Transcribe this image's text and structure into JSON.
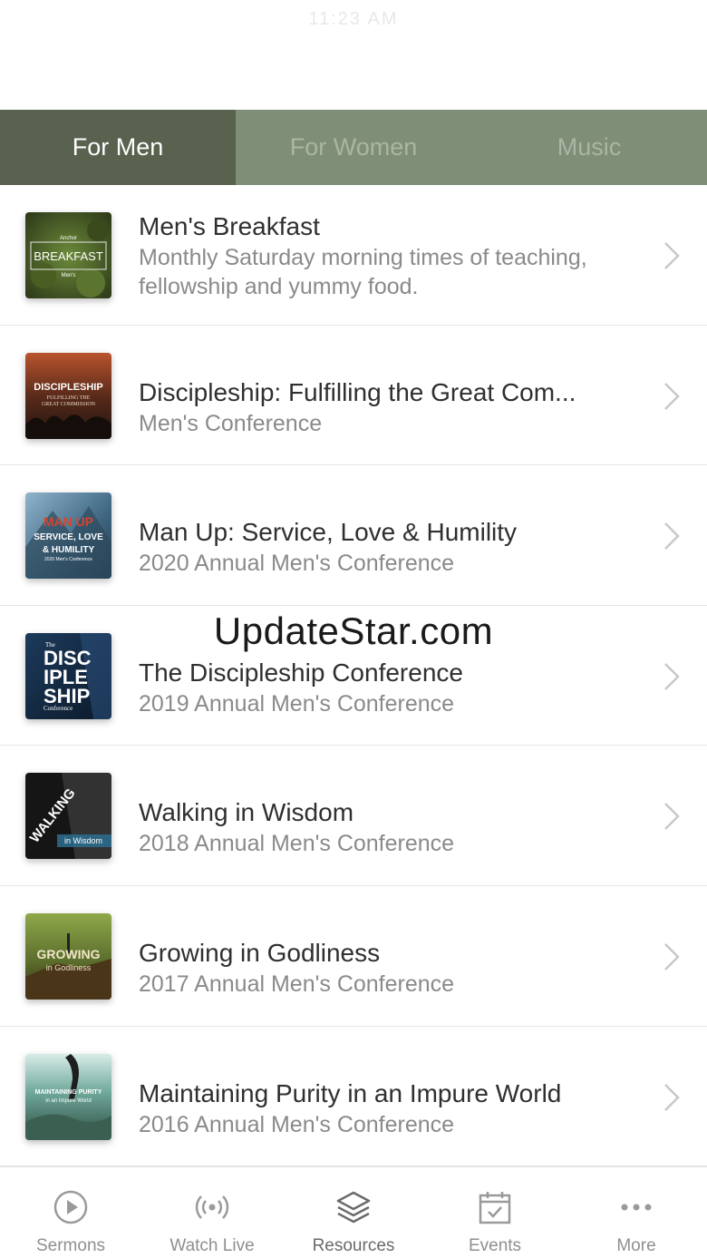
{
  "status": {
    "text": "11:23 AM"
  },
  "tabs": [
    {
      "label": "For Men",
      "active": true
    },
    {
      "label": "For Women",
      "active": false
    },
    {
      "label": "Music",
      "active": false
    }
  ],
  "items": [
    {
      "title": "Men's Breakfast",
      "subtitle": "Monthly Saturday morning times of teaching, fellowship and yummy food.",
      "thumb_text": [
        "Anchor",
        "BREAKFAST",
        "Men's"
      ]
    },
    {
      "title": "Discipleship: Fulfilling the Great Com...",
      "subtitle": "Men's Conference",
      "thumb_text": [
        "DISCIPLESHIP",
        "FULFILLING THE",
        "GREAT COMMISSION"
      ]
    },
    {
      "title": "Man Up: Service, Love & Humility",
      "subtitle": "2020 Annual Men's Conference",
      "thumb_text": [
        "MAN UP",
        "SERVICE, LOVE",
        "& HUMILITY",
        "2020 Men's Conference"
      ]
    },
    {
      "title": "The Discipleship Conference",
      "subtitle": "2019 Annual Men's Conference",
      "thumb_text": [
        "The",
        "DISC",
        "IPLE",
        "SHIP",
        "Conference"
      ]
    },
    {
      "title": "Walking in Wisdom",
      "subtitle": "2018 Annual Men's Conference",
      "thumb_text": [
        "WALKING",
        "in Wisdom"
      ]
    },
    {
      "title": "Growing in Godliness",
      "subtitle": "2017 Annual Men's Conference",
      "thumb_text": [
        "GROWING",
        "in Godliness"
      ]
    },
    {
      "title": "Maintaining Purity in an Impure World",
      "subtitle": "2016 Annual Men's Conference",
      "thumb_text": [
        "MAINTAINING PURITY",
        "in an Impure World"
      ]
    }
  ],
  "watermark": "UpdateStar.com",
  "tabbar": [
    {
      "label": "Sermons",
      "icon": "play-circle-icon"
    },
    {
      "label": "Watch Live",
      "icon": "broadcast-icon"
    },
    {
      "label": "Resources",
      "icon": "layers-icon",
      "active": true
    },
    {
      "label": "Events",
      "icon": "calendar-check-icon"
    },
    {
      "label": "More",
      "icon": "more-dots-icon"
    }
  ],
  "colors": {
    "tab_bg": "#7f8e77",
    "tab_active_bg": "#58624f",
    "tab_inactive_text": "#aab5a3"
  }
}
